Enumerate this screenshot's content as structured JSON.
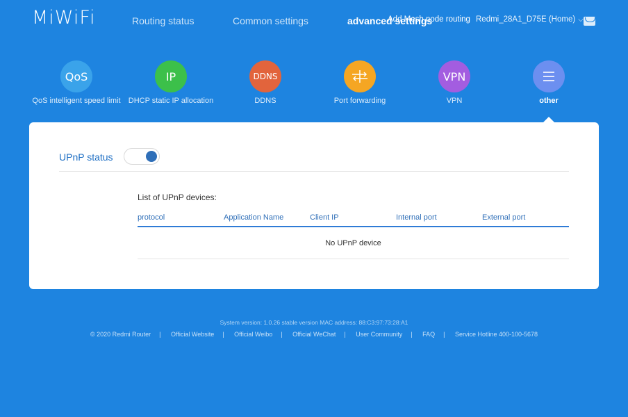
{
  "header": {
    "logo": "MiWiFi",
    "tabs": [
      {
        "label": "Routing status"
      },
      {
        "label": "Common settings"
      },
      {
        "label": "advanced settings"
      }
    ],
    "mode_link": "Add Mesh node routing",
    "router_name": "Redmi_28A1_D75E (Home)"
  },
  "features": [
    {
      "icon_text": "QoS",
      "label": "QoS intelligent speed limit",
      "color": "#3aa3ea"
    },
    {
      "icon_text": "IP",
      "label": "DHCP static IP allocation",
      "color": "#3cc04a"
    },
    {
      "icon_text": "DDNS",
      "label": "DDNS",
      "color": "#e2643c"
    },
    {
      "icon_text": "",
      "label": "Port forwarding",
      "color": "#f5a623",
      "icon": "port-forward-icon"
    },
    {
      "icon_text": "VPN",
      "label": "VPN",
      "color": "#a35de0"
    },
    {
      "icon_text": "",
      "label": "other",
      "color": "#6c8ff0",
      "icon": "menu-icon"
    }
  ],
  "upnp": {
    "status_label": "UPnP status",
    "enabled": true,
    "list_title": "List of UPnP devices:",
    "columns": [
      "protocol",
      "Application Name",
      "Client IP",
      "Internal port",
      "External port"
    ],
    "empty_text": "No UPnP device"
  },
  "footer": {
    "version": "System version: 1.0.26 stable version MAC address: 88:C3:97:73:28:A1",
    "links": [
      "© 2020 Redmi Router",
      "Official Website",
      "Official Weibo",
      "Official WeChat",
      "User Community",
      "FAQ",
      "Service Hotline 400-100-5678"
    ]
  }
}
